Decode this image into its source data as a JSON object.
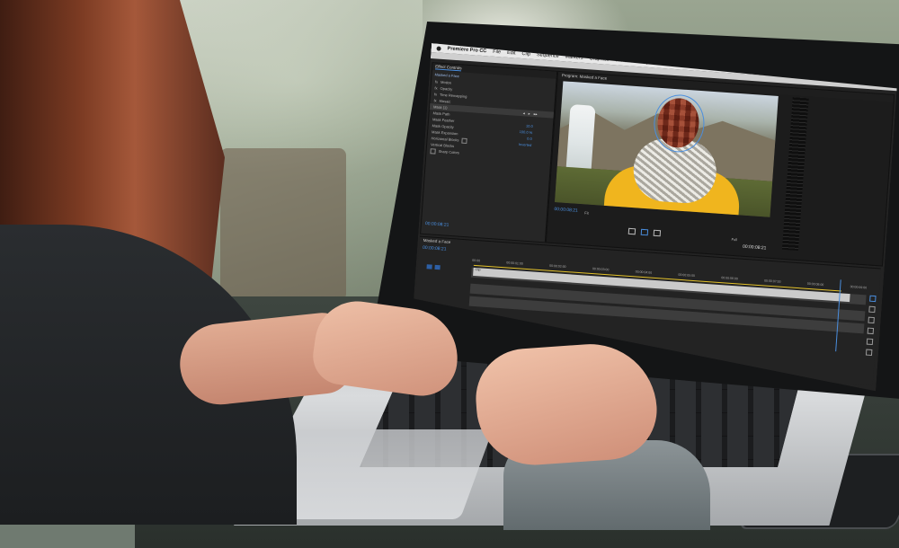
{
  "menubar": {
    "app_name": "Premiere Pro CC",
    "items": [
      "File",
      "Edit",
      "Clip",
      "Sequence",
      "Markers",
      "Graphics",
      "Window",
      "Help"
    ]
  },
  "effect_controls": {
    "tabs": [
      "Effect Controls"
    ],
    "clip": "Masked a Face",
    "rows": [
      {
        "label": "Motion"
      },
      {
        "label": "Opacity"
      },
      {
        "label": "Time Remapping"
      },
      {
        "label": "Mosaic"
      },
      {
        "label": "Mask (1)"
      },
      {
        "label": "Mask Path"
      },
      {
        "label": "Mask Feather",
        "value": "10.0"
      },
      {
        "label": "Mask Opacity",
        "value": "100.0 %"
      },
      {
        "label": "Mask Expansion",
        "value": "0.0"
      },
      {
        "label": "Horizontal Blocks",
        "value": "Inverted"
      },
      {
        "label": "Vertical Blocks"
      },
      {
        "label": "Sharp Colors"
      }
    ],
    "timecode": "00:00:08:21"
  },
  "program_monitor": {
    "title": "Program: Masked a Face",
    "timecode_left": "00:00:08:21",
    "timecode_right": "00:00:08:21",
    "fit": "Fit",
    "quality": "Full"
  },
  "timeline": {
    "title": "Masked a Face",
    "timecode": "00:00:08:21",
    "ruler": [
      "00:00",
      "00:00:01:00",
      "00:00:02:00",
      "00:00:03:00",
      "00:00:04:00",
      "00:00:05:00",
      "00:00:06:00",
      "00:00:07:00",
      "00:00:08:00",
      "00:00:09:00"
    ],
    "clip_label": "Clip"
  },
  "colors": {
    "accent": "#4a8ede",
    "work_area": "#e5c32b"
  }
}
